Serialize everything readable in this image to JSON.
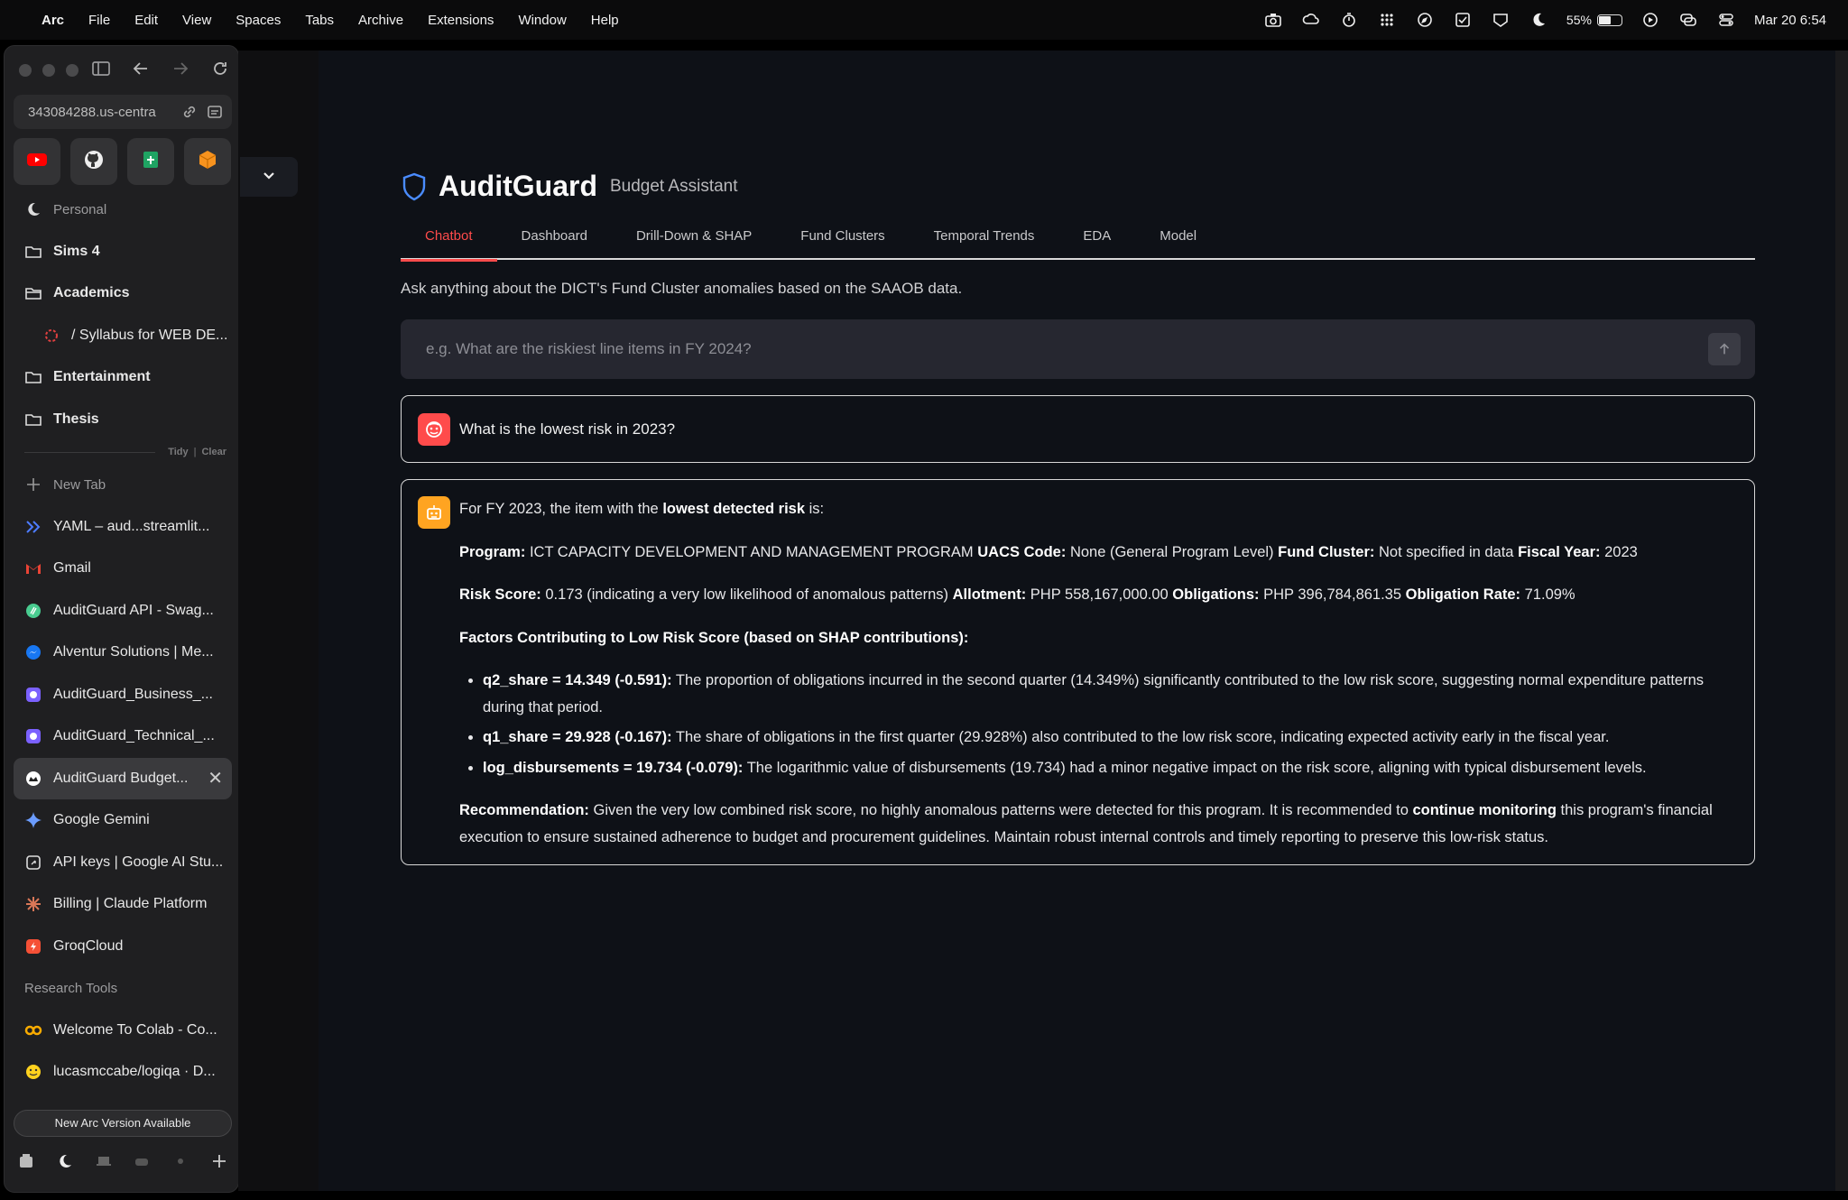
{
  "menubar": {
    "app": "Arc",
    "items": [
      "File",
      "Edit",
      "View",
      "Spaces",
      "Tabs",
      "Archive",
      "Extensions",
      "Window",
      "Help"
    ],
    "battery": "55%",
    "clock": "Mar 20  6:54"
  },
  "sidebar": {
    "url": "343084288.us-centra",
    "pinned": [
      "youtube-icon",
      "github-icon",
      "sheets-icon",
      "box-icon"
    ],
    "space_name": "Personal",
    "folders": [
      {
        "label": "Sims 4"
      },
      {
        "label": "Academics"
      },
      {
        "label": "/ Syllabus for WEB DE..."
      },
      {
        "label": "Entertainment"
      },
      {
        "label": "Thesis"
      }
    ],
    "tidy": "Tidy",
    "clear": "Clear",
    "new_tab": "New Tab",
    "tabs": [
      {
        "label": "YAML – aud...streamlit..."
      },
      {
        "label": "Gmail"
      },
      {
        "label": "AuditGuard API - Swag..."
      },
      {
        "label": "Alventur Solutions | Me..."
      },
      {
        "label": "AuditGuard_Business_..."
      },
      {
        "label": "AuditGuard_Technical_..."
      },
      {
        "label": "AuditGuard Budget..."
      },
      {
        "label": "Google Gemini"
      },
      {
        "label": "API keys | Google AI Stu..."
      },
      {
        "label": "Billing | Claude Platform"
      },
      {
        "label": "GroqCloud"
      }
    ],
    "research_section": "Research Tools",
    "research_tabs": [
      {
        "label": "Welcome To Colab - Co..."
      },
      {
        "label": "lucasmccabe/logiqa · D..."
      }
    ],
    "update_label": "New Arc Version Available"
  },
  "app": {
    "title": "AuditGuard",
    "subtitle": "Budget Assistant",
    "tabs": [
      "Chatbot",
      "Dashboard",
      "Drill-Down & SHAP",
      "Fund Clusters",
      "Temporal Trends",
      "EDA",
      "Model"
    ],
    "active_tab": "Chatbot",
    "intro": "Ask anything about the DICT's Fund Cluster anomalies based on the SAAOB data.",
    "input_placeholder": "e.g. What are the riskiest line items in FY 2024?"
  },
  "chat": {
    "user_message": "What is the lowest risk in 2023?",
    "bot": {
      "intro_prefix": "For FY 2023, the item with the ",
      "intro_bold": "lowest detected risk",
      "intro_suffix": " is:",
      "program_label": "Program:",
      "program_value": " ICT CAPACITY DEVELOPMENT AND MANAGEMENT PROGRAM ",
      "uacs_label": "UACS Code:",
      "uacs_value": " None (General Program Level) ",
      "cluster_label": "Fund Cluster:",
      "cluster_value": " Not specified in data ",
      "fy_label": "Fiscal Year:",
      "fy_value": " 2023",
      "risk_label": "Risk Score:",
      "risk_value": " 0.173 (indicating a very low likelihood of anomalous patterns) ",
      "allot_label": "Allotment:",
      "allot_value": " PHP 558,167,000.00 ",
      "oblig_label": "Obligations:",
      "oblig_value": " PHP 396,784,861.35 ",
      "rate_label": "Obligation Rate:",
      "rate_value": " 71.09%",
      "factors_heading": "Factors Contributing to Low Risk Score (based on SHAP contributions):",
      "factors": [
        {
          "label": "q2_share = 14.349 (-0.591):",
          "text": " The proportion of obligations incurred in the second quarter (14.349%) significantly contributed to the low risk score, suggesting normal expenditure patterns during that period."
        },
        {
          "label": "q1_share = 29.928 (-0.167):",
          "text": " The share of obligations in the first quarter (29.928%) also contributed to the low risk score, indicating expected activity early in the fiscal year."
        },
        {
          "label": "log_disbursements = 19.734 (-0.079):",
          "text": " The logarithmic value of disbursements (19.734) had a minor negative impact on the risk score, aligning with typical disbursement levels."
        }
      ],
      "rec_label": "Recommendation:",
      "rec_text1": " Given the very low combined risk score, no highly anomalous patterns were detected for this program. It is recommended to ",
      "rec_bold": "continue monitoring",
      "rec_text2": " this program's financial execution to ensure sustained adherence to budget and procurement guidelines. Maintain robust internal controls and timely reporting to preserve this low-risk status."
    }
  },
  "colors": {
    "accent": "#ff4b4b",
    "bot_avatar": "#ffa421",
    "background": "#0e1117"
  }
}
